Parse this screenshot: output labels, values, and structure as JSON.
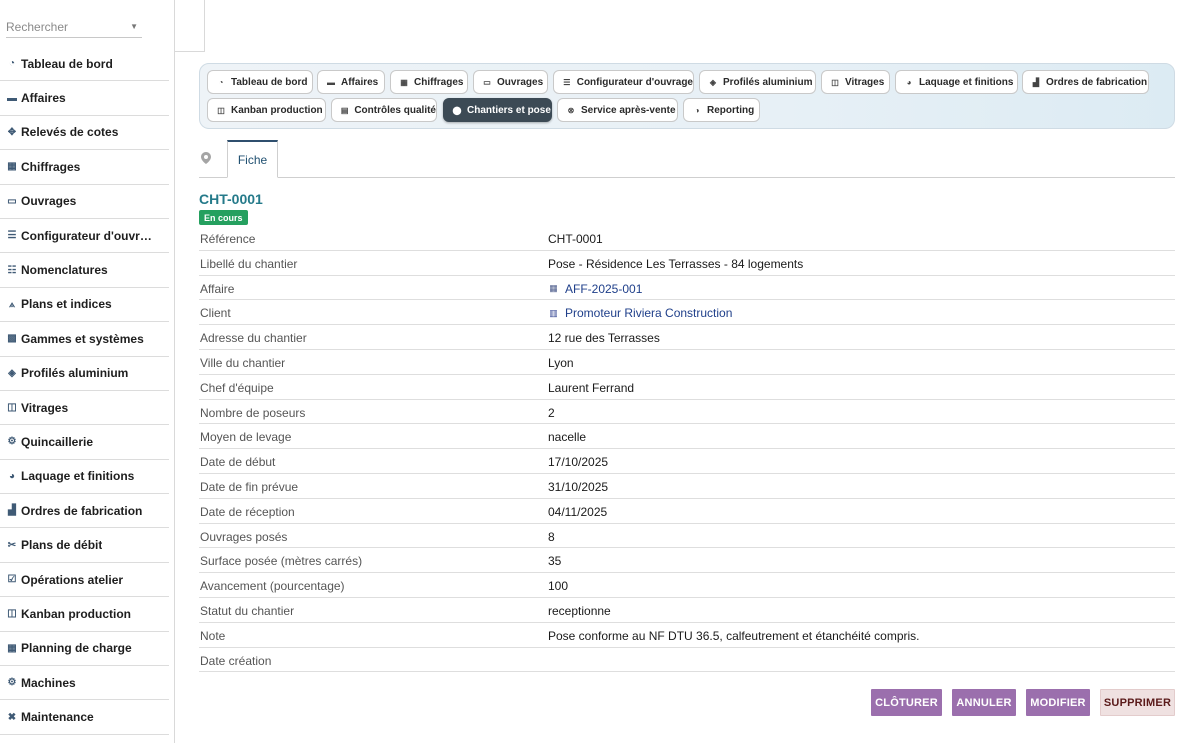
{
  "search": {
    "placeholder": "Rechercher"
  },
  "sidebar": {
    "items": [
      {
        "label": "Tableau de bord",
        "icon": "dashboard-icon"
      },
      {
        "label": "Affaires",
        "icon": "briefcase-icon"
      },
      {
        "label": "Relevés de cotes",
        "icon": "ruler-cross-icon"
      },
      {
        "label": "Chiffrages",
        "icon": "calculator-icon"
      },
      {
        "label": "Ouvrages",
        "icon": "window-icon"
      },
      {
        "label": "Configurateur d'ouvr…",
        "icon": "sliders-icon"
      },
      {
        "label": "Nomenclatures",
        "icon": "list-icon"
      },
      {
        "label": "Plans et indices",
        "icon": "compass-icon"
      },
      {
        "label": "Gammes et systèmes",
        "icon": "grid-icon"
      },
      {
        "label": "Profilés aluminium",
        "icon": "layers-icon"
      },
      {
        "label": "Vitrages",
        "icon": "panel-icon"
      },
      {
        "label": "Quincaillerie",
        "icon": "gears-icon"
      },
      {
        "label": "Laquage et finitions",
        "icon": "palette-icon"
      },
      {
        "label": "Ordres de fabrication",
        "icon": "factory-icon"
      },
      {
        "label": "Plans de débit",
        "icon": "scissors-icon"
      },
      {
        "label": "Opérations atelier",
        "icon": "checklist-icon"
      },
      {
        "label": "Kanban production",
        "icon": "kanban-icon"
      },
      {
        "label": "Planning de charge",
        "icon": "calendar-icon"
      },
      {
        "label": "Machines",
        "icon": "gears-icon"
      },
      {
        "label": "Maintenance",
        "icon": "tools-icon"
      }
    ]
  },
  "topnav": {
    "pills": [
      {
        "label": "Tableau de bord",
        "icon": "dashboard-icon"
      },
      {
        "label": "Affaires",
        "icon": "briefcase-icon"
      },
      {
        "label": "Chiffrages",
        "icon": "calculator-icon"
      },
      {
        "label": "Ouvrages",
        "icon": "window-icon"
      },
      {
        "label": "Configurateur d'ouvrage",
        "icon": "sliders-icon"
      },
      {
        "label": "Profilés aluminium",
        "icon": "layers-icon"
      },
      {
        "label": "Vitrages",
        "icon": "panel-icon"
      },
      {
        "label": "Laquage et finitions",
        "icon": "palette-icon"
      },
      {
        "label": "Ordres de fabrication",
        "icon": "factory-icon"
      },
      {
        "label": "Kanban production",
        "icon": "kanban-icon"
      },
      {
        "label": "Contrôles qualité",
        "icon": "clipboard-icon"
      },
      {
        "label": "Chantiers et pose",
        "icon": "map-pin-icon",
        "active": true
      },
      {
        "label": "Service après-vente",
        "icon": "lifebuoy-icon"
      },
      {
        "label": "Reporting",
        "icon": "pie-chart-icon"
      }
    ]
  },
  "record": {
    "tab_label": "Fiche",
    "title": "CHT-0001",
    "status_badge": "En cours",
    "fields": [
      {
        "label": "Référence",
        "value": "CHT-0001"
      },
      {
        "label": "Libellé du chantier",
        "value": "Pose - Résidence Les Terrasses - 84 logements"
      },
      {
        "label": "Affaire",
        "value": "AFF-2025-001",
        "link": true
      },
      {
        "label": "Client",
        "value": "Promoteur Riviera Construction",
        "link": true
      },
      {
        "label": "Adresse du chantier",
        "value": "12 rue des Terrasses"
      },
      {
        "label": "Ville du chantier",
        "value": "Lyon"
      },
      {
        "label": "Chef d'équipe",
        "value": "Laurent Ferrand"
      },
      {
        "label": "Nombre de poseurs",
        "value": "2"
      },
      {
        "label": "Moyen de levage",
        "value": "nacelle"
      },
      {
        "label": "Date de début",
        "value": "17/10/2025"
      },
      {
        "label": "Date de fin prévue",
        "value": "31/10/2025"
      },
      {
        "label": "Date de réception",
        "value": "04/11/2025"
      },
      {
        "label": "Ouvrages posés",
        "value": "8"
      },
      {
        "label": "Surface posée (mètres carrés)",
        "value": "35"
      },
      {
        "label": "Avancement (pourcentage)",
        "value": "100"
      },
      {
        "label": "Statut du chantier",
        "value": "receptionne"
      },
      {
        "label": "Note",
        "value": "Pose conforme au NF DTU 36.5, calfeutrement et étanchéité compris."
      },
      {
        "label": "Date création",
        "value": ""
      }
    ]
  },
  "actions": {
    "close_label": "CLÔTURER",
    "cancel_label": "ANNULER",
    "edit_label": "MODIFIER",
    "delete_label": "SUPPRIMER"
  },
  "colors": {
    "accent_teal": "#257a8a",
    "badge_green": "#25a05f",
    "action_purple": "#9b6fad",
    "active_pill": "#3c4a55",
    "link_blue": "#1f3f8a"
  }
}
